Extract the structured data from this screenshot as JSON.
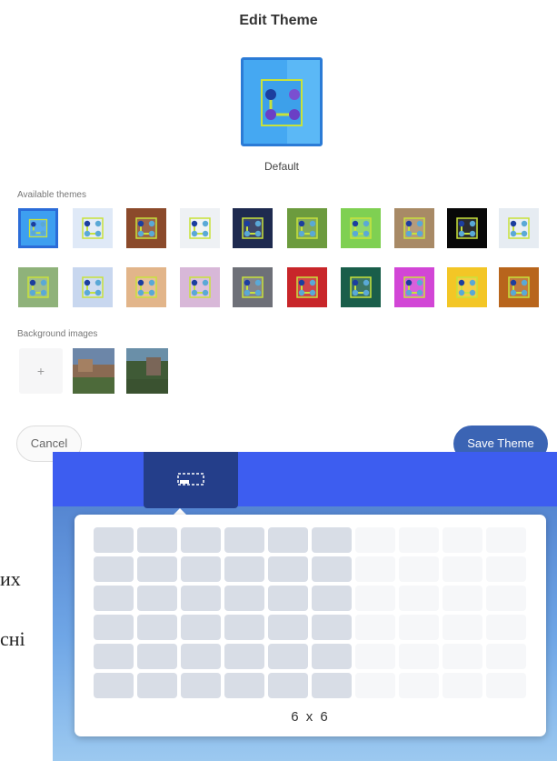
{
  "dialog": {
    "title": "Edit Theme",
    "current_theme_label": "Default",
    "available_label": "Available themes",
    "background_label": "Background images",
    "add_background_label": "+",
    "cancel_label": "Cancel",
    "save_label": "Save Theme"
  },
  "themes": [
    {
      "name": "theme-1",
      "color": "#3d9ff0"
    },
    {
      "name": "theme-2",
      "color": "#dfe9f7"
    },
    {
      "name": "theme-3",
      "color": "#8b4a2b"
    },
    {
      "name": "theme-4",
      "color": "#eef1f4"
    },
    {
      "name": "theme-5",
      "color": "#1e2a4f"
    },
    {
      "name": "theme-6",
      "color": "#6c9b3e"
    },
    {
      "name": "theme-7",
      "color": "#7fd052"
    },
    {
      "name": "theme-8",
      "color": "#a88a66"
    },
    {
      "name": "theme-9",
      "color": "#080808"
    },
    {
      "name": "theme-10",
      "color": "#e6ecf2"
    },
    {
      "name": "theme-11",
      "color": "#8fb27a"
    },
    {
      "name": "theme-12",
      "color": "#c8d7ef"
    },
    {
      "name": "theme-13",
      "color": "#e2b58a"
    },
    {
      "name": "theme-14",
      "color": "#d8b8d8"
    },
    {
      "name": "theme-15",
      "color": "#6e7078"
    },
    {
      "name": "theme-16",
      "color": "#c8262a"
    },
    {
      "name": "theme-17",
      "color": "#1a5e4a"
    },
    {
      "name": "theme-18",
      "color": "#d246d6"
    },
    {
      "name": "theme-19",
      "color": "#f3c626"
    },
    {
      "name": "theme-20",
      "color": "#b8651c"
    }
  ],
  "selected_theme": "theme-1",
  "accent_color": "#3b64b4",
  "grid_picker": {
    "size_text": "6 x 6",
    "columns": 10,
    "rows": 6,
    "selected_columns": 6,
    "selected_rows": 6
  },
  "side_text": [
    "их",
    "сні"
  ]
}
